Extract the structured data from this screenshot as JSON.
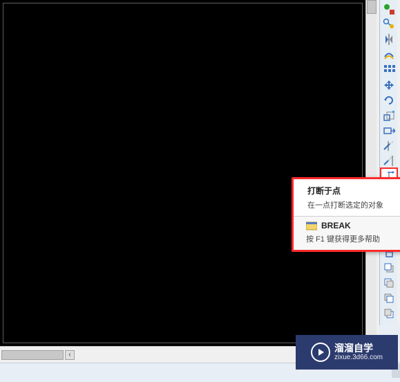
{
  "tooltip": {
    "title": "打断于点",
    "description": "在一点打断选定的对象",
    "command": "BREAK",
    "help": "按 F1 键获得更多帮助"
  },
  "watermark": {
    "main": "溜溜自学",
    "sub": "zixue.3d66.com"
  },
  "toolbar": {
    "items": [
      {
        "name": "properties-icon"
      },
      {
        "name": "match-props-icon"
      },
      {
        "name": "mirror-icon"
      },
      {
        "name": "offset-icon"
      },
      {
        "name": "array-icon"
      },
      {
        "name": "move-icon"
      },
      {
        "name": "rotate-icon"
      },
      {
        "name": "scale-icon"
      },
      {
        "name": "stretch-icon"
      },
      {
        "name": "trim-icon"
      },
      {
        "name": "extend-icon"
      },
      {
        "name": "break-at-point-icon"
      },
      {
        "name": "break-icon"
      },
      {
        "name": "join-icon"
      },
      {
        "name": "chamfer-icon"
      },
      {
        "name": "fillet-icon"
      },
      {
        "name": "explode-icon"
      },
      {
        "name": "copy-front-icon"
      },
      {
        "name": "copy-back-icon"
      },
      {
        "name": "under-icon"
      },
      {
        "name": "front-icon"
      }
    ],
    "highlighted_index": 11
  },
  "colors": {
    "highlight_border": "#ff2a2a",
    "toolbar_bg": "#e6eef5",
    "watermark_bg": "#2c3b6e"
  }
}
